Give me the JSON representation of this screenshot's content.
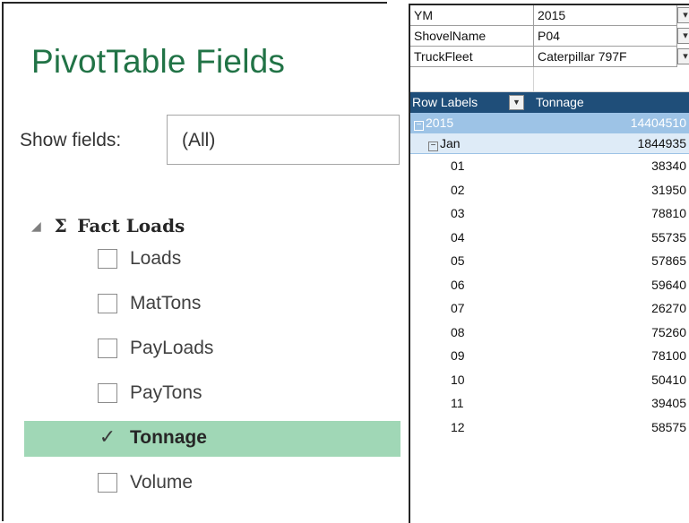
{
  "fields_pane": {
    "title": "PivotTable Fields",
    "show_fields_label": "Show fields:",
    "show_fields_value": "(All)",
    "table_collapse_glyph": "◢",
    "table_sigma": "Σ",
    "table_name": "Fact Loads",
    "fields": [
      {
        "label": "Loads",
        "checked": false
      },
      {
        "label": "MatTons",
        "checked": false
      },
      {
        "label": "PayLoads",
        "checked": false
      },
      {
        "label": "PayTons",
        "checked": false
      },
      {
        "label": "Tonnage",
        "checked": true
      },
      {
        "label": "Volume",
        "checked": false
      }
    ],
    "check_glyph": "✓",
    "selected_color": "#a0d7b6",
    "accent_color": "#217346"
  },
  "pivot": {
    "filters": [
      {
        "name": "YM",
        "value": "2015"
      },
      {
        "name": "ShovelName",
        "value": "P04"
      },
      {
        "name": "TruckFleet",
        "value": "Caterpillar 797F"
      }
    ],
    "filter_icon": "filter-icon",
    "header": {
      "row_labels": "Row Labels",
      "value_field": "Tonnage"
    },
    "year": {
      "label": "2015",
      "total": "14404510"
    },
    "month": {
      "label": "Jan",
      "total": "1844935"
    },
    "days": [
      {
        "label": "01",
        "value": "38340"
      },
      {
        "label": "02",
        "value": "31950"
      },
      {
        "label": "03",
        "value": "78810"
      },
      {
        "label": "04",
        "value": "55735"
      },
      {
        "label": "05",
        "value": "57865"
      },
      {
        "label": "06",
        "value": "59640"
      },
      {
        "label": "07",
        "value": "26270"
      },
      {
        "label": "08",
        "value": "75260"
      },
      {
        "label": "09",
        "value": "78100"
      },
      {
        "label": "10",
        "value": "50410"
      },
      {
        "label": "11",
        "value": "39405"
      },
      {
        "label": "12",
        "value": "58575"
      }
    ],
    "header_color": "#1f4e79",
    "year_row_color": "#9dc3e6",
    "month_row_color": "#deebf7"
  }
}
